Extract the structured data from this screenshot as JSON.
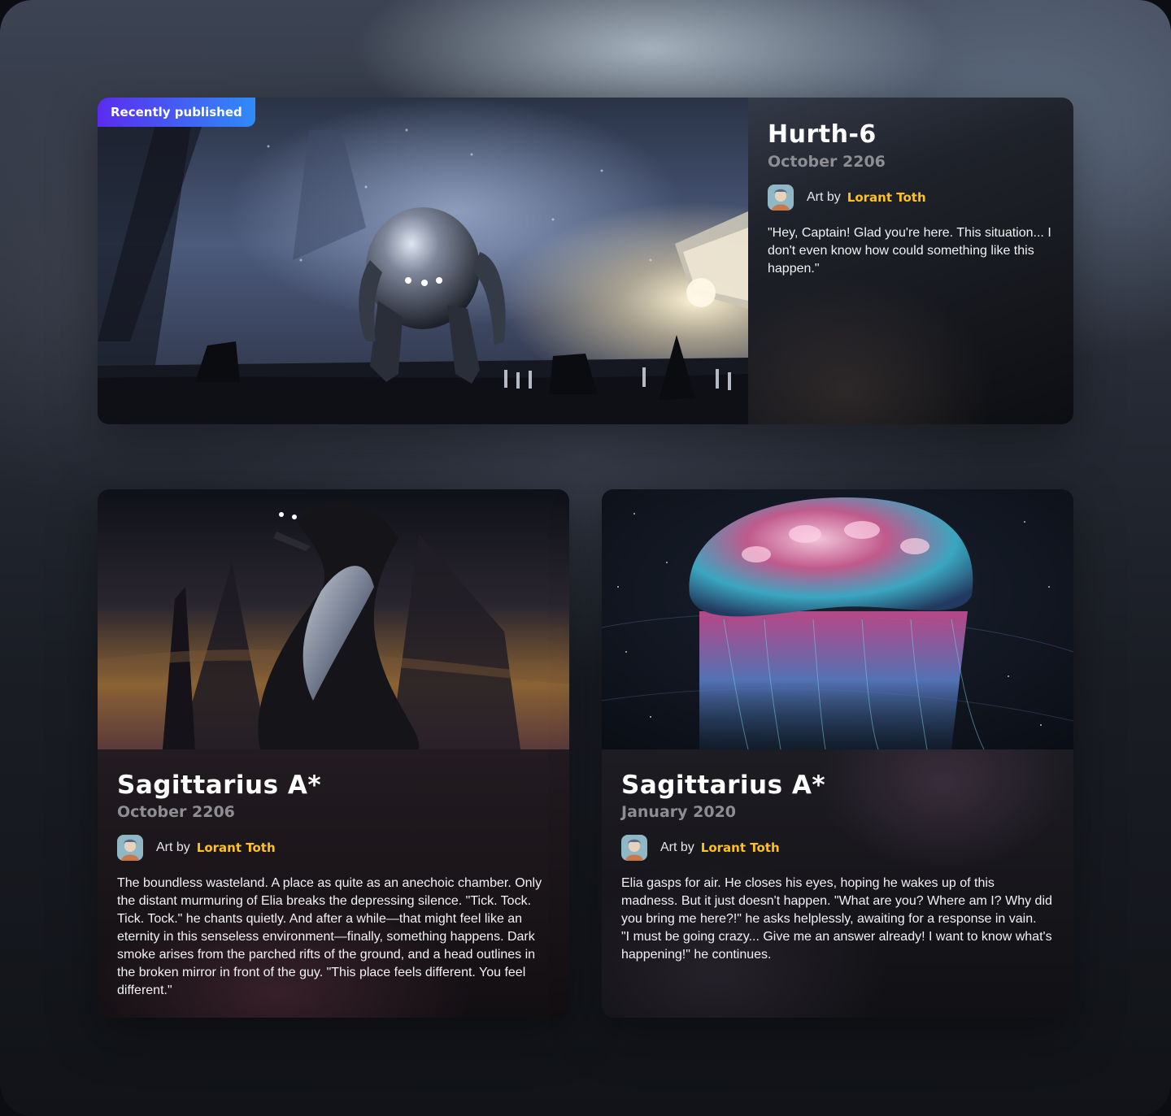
{
  "featured": {
    "badge": "Recently published",
    "title": "Hurth-6",
    "date": "October 2206",
    "art_by_label": "Art by",
    "artist": "Lorant Toth",
    "description": "\"Hey, Captain! Glad you're here. This situation... I don't even know how could something like this happen.\""
  },
  "stories": [
    {
      "title": "Sagittarius A*",
      "date": "October 2206",
      "art_by_label": "Art by",
      "artist": "Lorant Toth",
      "description": "The boundless wasteland. A place as quite as an anechoic chamber. Only the distant murmuring of Elia breaks the depressing silence. \"Tick. Tock. Tick. Tock.\" he chants quietly. And after a while—that might feel like an eternity in this senseless environment—finally, something happens. Dark smoke arises from the parched rifts of the ground, and a head outlines in the broken mirror in front of the guy. \"This place feels different. You feel different.\""
    },
    {
      "title": "Sagittarius A*",
      "date": "January 2020",
      "art_by_label": "Art by",
      "artist": "Lorant Toth",
      "description_lines": [
        "Elia gasps for air. He closes his eyes, hoping he wakes up of this madness. But it just doesn't happen. \"What are you? Where am I? Why did you bring me here?!\" he asks helplessly, awaiting for a response in vain.",
        "\"I must be going crazy... Give me an answer already! I want to know what's happening!\" he continues."
      ]
    }
  ],
  "colors": {
    "accent_artist": "#ffc21a",
    "badge_gradient_start": "#5a2cf0",
    "badge_gradient_end": "#2f8cf7",
    "title": "#ffffff",
    "date": "#8d8e93"
  },
  "icons": {
    "avatar": "astronaut-avatar",
    "hero_art": "robot-scene-illustration",
    "card1_art": "alien-creature-illustration",
    "card2_art": "space-jellyfish-illustration"
  }
}
